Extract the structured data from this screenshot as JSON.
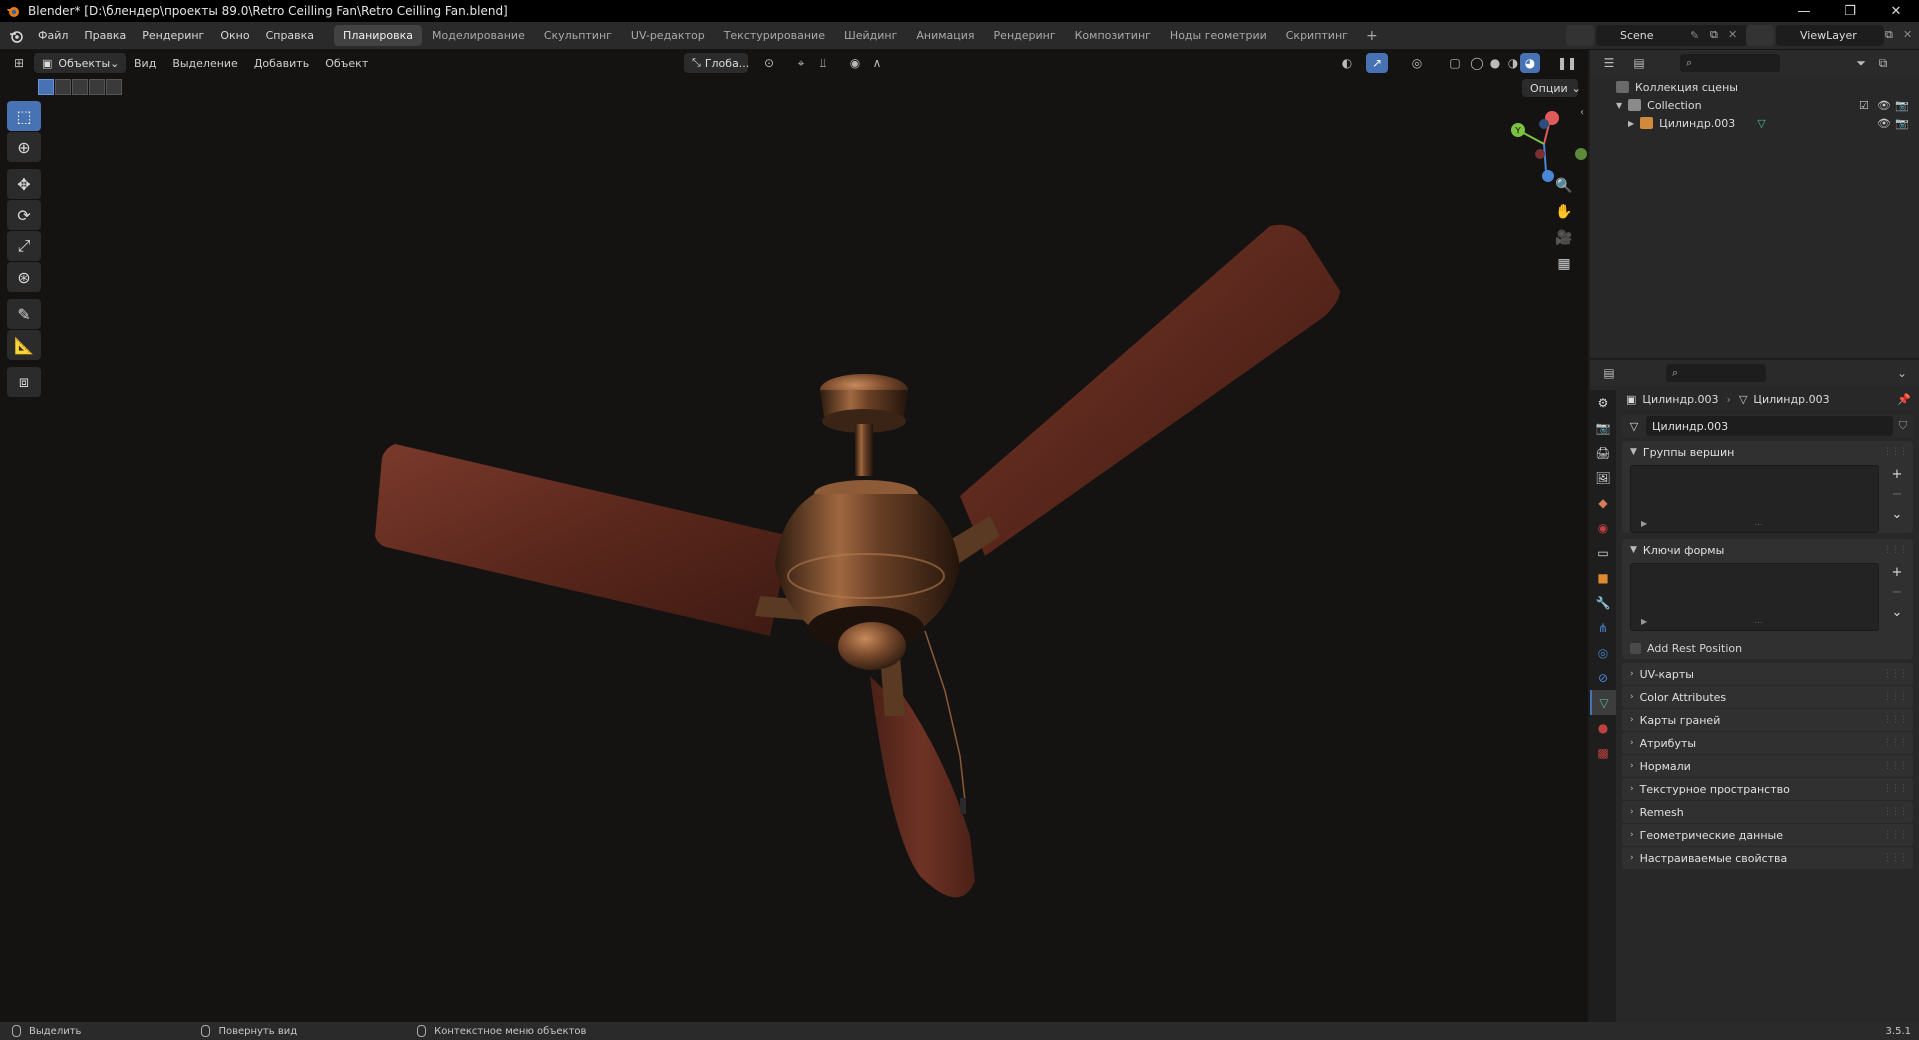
{
  "window": {
    "title": "Blender* [D:\\блендер\\проекты 89.0\\Retro Ceilling Fan\\Retro Ceilling Fan.blend]",
    "minimize": "—",
    "maximize": "❐",
    "close": "✕"
  },
  "menus": [
    "Файл",
    "Правка",
    "Рендеринг",
    "Окно",
    "Справка"
  ],
  "workspaces": [
    {
      "label": "Планировка",
      "active": true
    },
    {
      "label": "Моделирование",
      "active": false
    },
    {
      "label": "Скульптинг",
      "active": false
    },
    {
      "label": "UV-редактор",
      "active": false
    },
    {
      "label": "Текстурирование",
      "active": false
    },
    {
      "label": "Шейдинг",
      "active": false
    },
    {
      "label": "Анимация",
      "active": false
    },
    {
      "label": "Рендеринг",
      "active": false
    },
    {
      "label": "Композитинг",
      "active": false
    },
    {
      "label": "Ноды геометрии",
      "active": false
    },
    {
      "label": "Скриптинг",
      "active": false
    }
  ],
  "workspace_add": "+",
  "scene": {
    "name": "Scene",
    "view_layer": "ViewLayer"
  },
  "viewport": {
    "mode": "Объекты",
    "menus": [
      "Вид",
      "Выделение",
      "Добавить",
      "Объект"
    ],
    "transform_orientation": "Глоба...",
    "options": "Опции"
  },
  "outliner": {
    "root": "Коллекция сцены",
    "collection": "Collection",
    "object": "Цилиндр.003"
  },
  "properties": {
    "breadcrumb_object": "Цилиндр.003",
    "breadcrumb_mesh": "Цилиндр.003",
    "mesh_name": "Цилиндр.003",
    "vertex_groups": "Группы вершин",
    "shape_keys": "Ключи формы",
    "add_rest_position": "Add Rest Position",
    "collapsed_panels": [
      "UV-карты",
      "Color Attributes",
      "Карты граней",
      "Атрибуты",
      "Нормали",
      "Текстурное пространство",
      "Remesh",
      "Геометрические данные",
      "Настраиваемые свойства"
    ]
  },
  "statusbar": {
    "select": "Выделить",
    "rotate_view": "Повернуть вид",
    "context_menu": "Контекстное меню объектов",
    "version": "3.5.1"
  },
  "colors": {
    "accent": "#4772b3",
    "wood": "#6b2f22",
    "bronze": "#7a4a2c",
    "axis_x": "#e05a5a",
    "axis_y": "#7cc243",
    "axis_z": "#4a86d6"
  }
}
